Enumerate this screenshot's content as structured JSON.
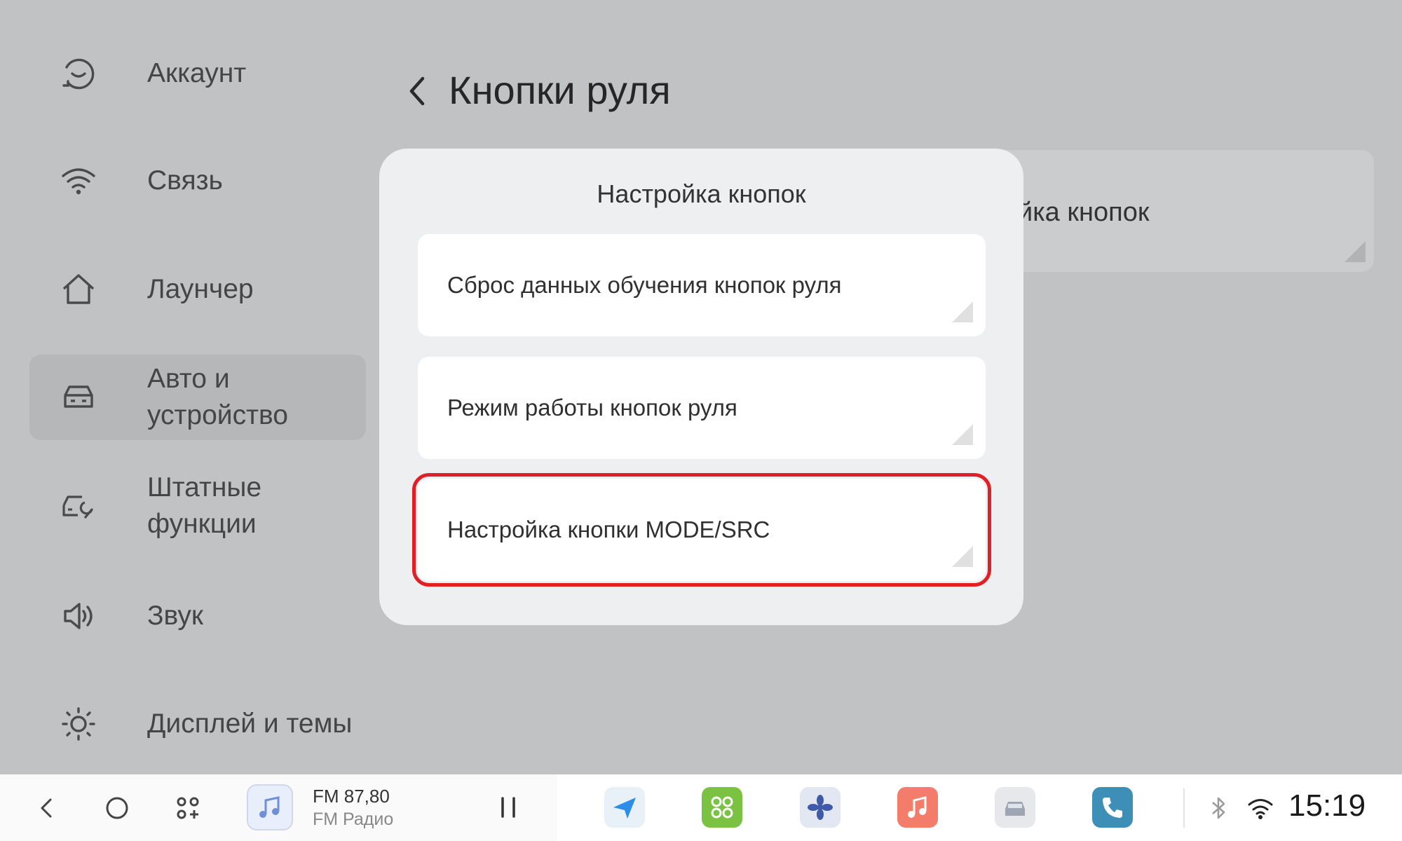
{
  "sidebar": {
    "items": [
      {
        "label": "Аккаунт",
        "icon": "account-icon"
      },
      {
        "label": "Связь",
        "icon": "wifi-icon"
      },
      {
        "label": "Лаунчер",
        "icon": "home-icon"
      },
      {
        "label": "Авто и устройство",
        "icon": "car-icon",
        "active": true
      },
      {
        "label": "Штатные функции",
        "icon": "car-wrench-icon"
      },
      {
        "label": "Звук",
        "icon": "speaker-icon"
      },
      {
        "label": "Дисплей и темы",
        "icon": "brightness-icon"
      }
    ]
  },
  "header": {
    "title": "Кнопки руля",
    "back_icon": "chevron-left-icon"
  },
  "background_card": {
    "label": "йка кнопок"
  },
  "dialog": {
    "title": "Настройка кнопок",
    "options": [
      {
        "label": "Сброс данных обучения кнопок руля"
      },
      {
        "label": "Режим работы кнопок руля"
      },
      {
        "label": "Настройка кнопки MODE/SRC",
        "highlighted": true
      }
    ],
    "highlight_color": "#e31f26"
  },
  "bottom_bar": {
    "nav": [
      "back-icon",
      "home-circle-icon",
      "apps-grid-icon"
    ],
    "media": {
      "frequency": "FM 87,80",
      "source": "FM Радио",
      "state_icon": "pause-icon"
    },
    "apps": [
      {
        "name": "navigation-icon",
        "color": "#e8f0f8"
      },
      {
        "name": "apps-launcher-icon",
        "color": "#7cc242"
      },
      {
        "name": "climate-fan-icon",
        "color": "#e3e7f2"
      },
      {
        "name": "music-app-icon",
        "color": "#f47c6a"
      },
      {
        "name": "car-settings-icon",
        "color": "#e6e8ec"
      },
      {
        "name": "phone-icon",
        "color": "#3e8fb8"
      }
    ],
    "status": {
      "bluetooth_icon": "bluetooth-icon",
      "wifi_icon": "wifi-status-icon",
      "time": "15:19"
    }
  }
}
